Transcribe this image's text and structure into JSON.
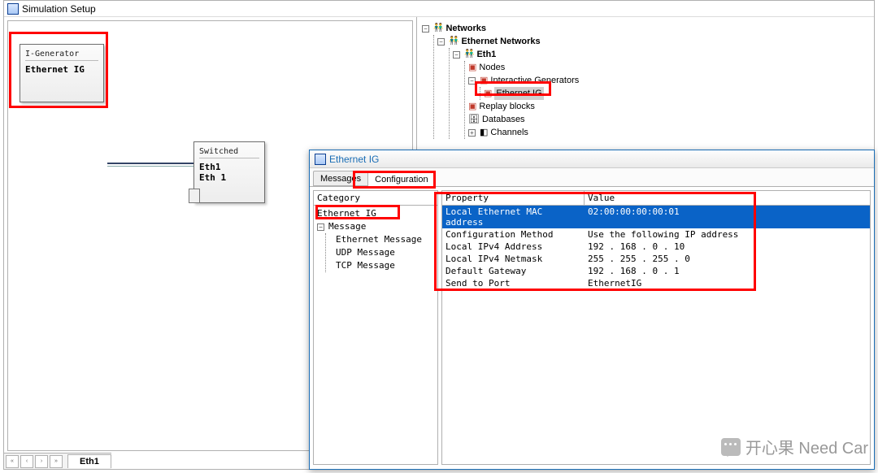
{
  "main": {
    "title": "Simulation Setup",
    "box1": {
      "head": "I-Generator",
      "label": "Ethernet IG"
    },
    "box2": {
      "head": "Switched",
      "line1": "Eth1",
      "line2": "Eth 1"
    },
    "bottom_tab": "Eth1"
  },
  "tree": {
    "root": "Networks",
    "group": "Ethernet Networks",
    "net": "Eth1",
    "nodes": "Nodes",
    "ig_folder": "Interactive Generators",
    "ig_item": "Ethernet IG",
    "replay": "Replay blocks",
    "db": "Databases",
    "ch": "Channels"
  },
  "child": {
    "title": "Ethernet IG",
    "tabs": {
      "messages": "Messages",
      "configuration": "Configuration"
    },
    "category": {
      "header": "Category",
      "root": "Ethernet IG",
      "message": "Message",
      "items": [
        "Ethernet Message",
        "UDP Message",
        "TCP Message"
      ]
    },
    "props": {
      "headers": {
        "property": "Property",
        "value": "Value"
      },
      "rows": [
        {
          "property": "Local Ethernet MAC address",
          "value": "02:00:00:00:00:01",
          "selected": true
        },
        {
          "property": "Configuration Method",
          "value": "Use the following IP address"
        },
        {
          "property": "Local IPv4 Address",
          "value": "192 . 168 .   0 . 10"
        },
        {
          "property": "Local IPv4 Netmask",
          "value": "255 . 255 . 255 .   0"
        },
        {
          "property": "Default Gateway",
          "value": "192 . 168 .   0 .   1"
        },
        {
          "property": "Send to Port",
          "value": "EthernetIG"
        }
      ]
    }
  },
  "watermark": "开心果 Need Car"
}
